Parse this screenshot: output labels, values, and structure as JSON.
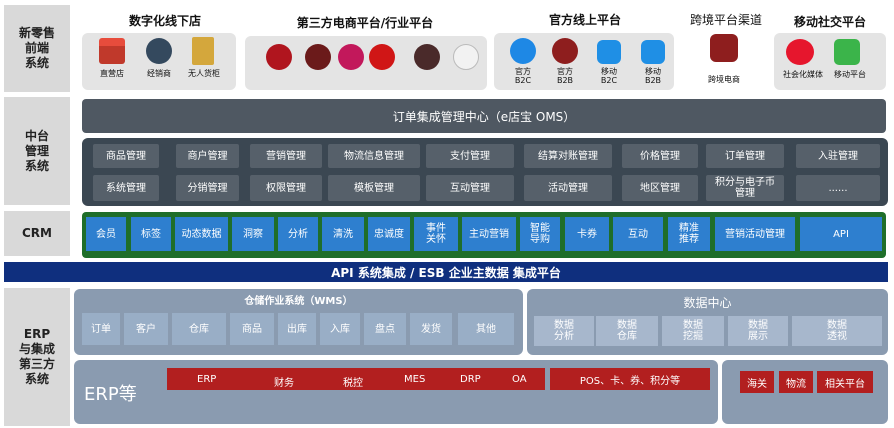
{
  "layers": {
    "retail": "新零售\n前端\n系统",
    "middle": "中台\n管理\n系统",
    "crm": "CRM",
    "erp": "ERP\n与集成\n第三方\n系统"
  },
  "front": {
    "offline_title": "数字化线下店",
    "offline": [
      "直营店",
      "经销商",
      "无人货柜"
    ],
    "ecom_title": "第三方电商平台/行业平台",
    "ecom_logos": [
      "Tmall",
      "amazon",
      "VIP",
      "JD.COM",
      "值得买",
      "Suning"
    ],
    "official_title": "官方线上平台",
    "official": [
      "官方\nB2C",
      "官方\nB2B",
      "移动\nB2C",
      "移动\nB2B"
    ],
    "cross_title": "跨境平台渠道",
    "cross": [
      "跨境电商"
    ],
    "social_title": "移动社交平台",
    "social": [
      "社会化媒体",
      "移动平台"
    ]
  },
  "oms_title": "订单集成管理中心（e店宝 OMS）",
  "mgmt_row1": [
    "商品管理",
    "商户管理",
    "营销管理",
    "物流信息管理",
    "支付管理",
    "结算对账管理",
    "价格管理",
    "订单管理",
    "入驻管理"
  ],
  "mgmt_row2": [
    "系统管理",
    "分销管理",
    "权限管理",
    "模板管理",
    "互动管理",
    "活动管理",
    "地区管理",
    "积分与电子币\n管理",
    "......"
  ],
  "crm_items": [
    "会员",
    "标签",
    "动态数据",
    "洞察",
    "分析",
    "清洗",
    "忠诚度",
    "事件\n关怀",
    "主动营销",
    "智能\n导购",
    "卡券",
    "互动",
    "精准\n推荐",
    "营销活动管理",
    "API"
  ],
  "api_bar": "API 系统集成 / ESB 企业主数据 集成平台",
  "wms": {
    "title": "仓储作业系统（WMS）",
    "items": [
      "订单",
      "客户",
      "仓库",
      "商品",
      "出库",
      "入库",
      "盘点",
      "发货",
      "其他"
    ]
  },
  "data_center": {
    "title": "数据中心",
    "items": [
      "数据\n分析",
      "数据\n仓库",
      "数据\n挖掘",
      "数据\n展示",
      "数据\n透视"
    ]
  },
  "erp_label": "ERP等",
  "erp_items": [
    "ERP",
    "财务",
    "税控",
    "MES",
    "DRP",
    "OA"
  ],
  "pos_label": "POS、卡、券、积分等",
  "right_items": [
    "海关",
    "物流",
    "相关平台"
  ],
  "colors": {
    "mgmt_bg": "#3b4752",
    "crm_green": "#1f6e2a",
    "crm_blue": "#2e7fcf",
    "api_bar": "#0f2f7e",
    "erp_red": "#b21f1f"
  }
}
